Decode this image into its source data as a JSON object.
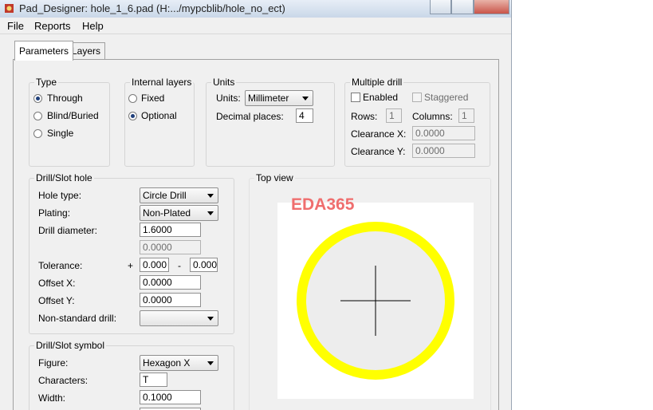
{
  "window": {
    "title": "Pad_Designer: hole_1_6.pad (H:.../mypcblib/hole_no_ect)"
  },
  "menu": {
    "file": "File",
    "reports": "Reports",
    "help": "Help"
  },
  "tabs": {
    "parameters": "Parameters",
    "layers": "Layers"
  },
  "type_group": {
    "label": "Type",
    "through": "Through",
    "blind_buried": "Blind/Buried",
    "single": "Single",
    "selected": "Through"
  },
  "internal_layers": {
    "label": "Internal layers",
    "fixed": "Fixed",
    "optional": "Optional",
    "selected": "Optional"
  },
  "units_group": {
    "label": "Units",
    "units_label": "Units:",
    "units_value": "Millimeter",
    "decimal_label": "Decimal places:",
    "decimal_value": "4"
  },
  "multiple_drill": {
    "label": "Multiple drill",
    "enabled": "Enabled",
    "staggered": "Staggered",
    "rows_label": "Rows:",
    "rows_value": "1",
    "columns_label": "Columns:",
    "columns_value": "1",
    "clearance_x_label": "Clearance X:",
    "clearance_x_value": "0.0000",
    "clearance_y_label": "Clearance Y:",
    "clearance_y_value": "0.0000"
  },
  "drill_slot_hole": {
    "label": "Drill/Slot hole",
    "hole_type_label": "Hole type:",
    "hole_type_value": "Circle Drill",
    "plating_label": "Plating:",
    "plating_value": "Non-Plated",
    "drill_diameter_label": "Drill diameter:",
    "drill_diameter_value": "1.6000",
    "second_value": "0.0000",
    "tolerance_label": "Tolerance:",
    "tol_plus": "+",
    "tol_plus_value": "0.000",
    "tol_minus": "-",
    "tol_minus_value": "0.000",
    "offset_x_label": "Offset X:",
    "offset_x_value": "0.0000",
    "offset_y_label": "Offset Y:",
    "offset_y_value": "0.0000",
    "nonstandard_label": "Non-standard drill:",
    "nonstandard_value": ""
  },
  "drill_slot_symbol": {
    "label": "Drill/Slot symbol",
    "figure_label": "Figure:",
    "figure_value": "Hexagon X",
    "characters_label": "Characters:",
    "characters_value": "T",
    "width_label": "Width:",
    "width_value": "0.1000"
  },
  "top_view": {
    "label": "Top view",
    "watermark": "EDA365",
    "ring_color": "#ffff00",
    "fill_color": "#ededed"
  }
}
